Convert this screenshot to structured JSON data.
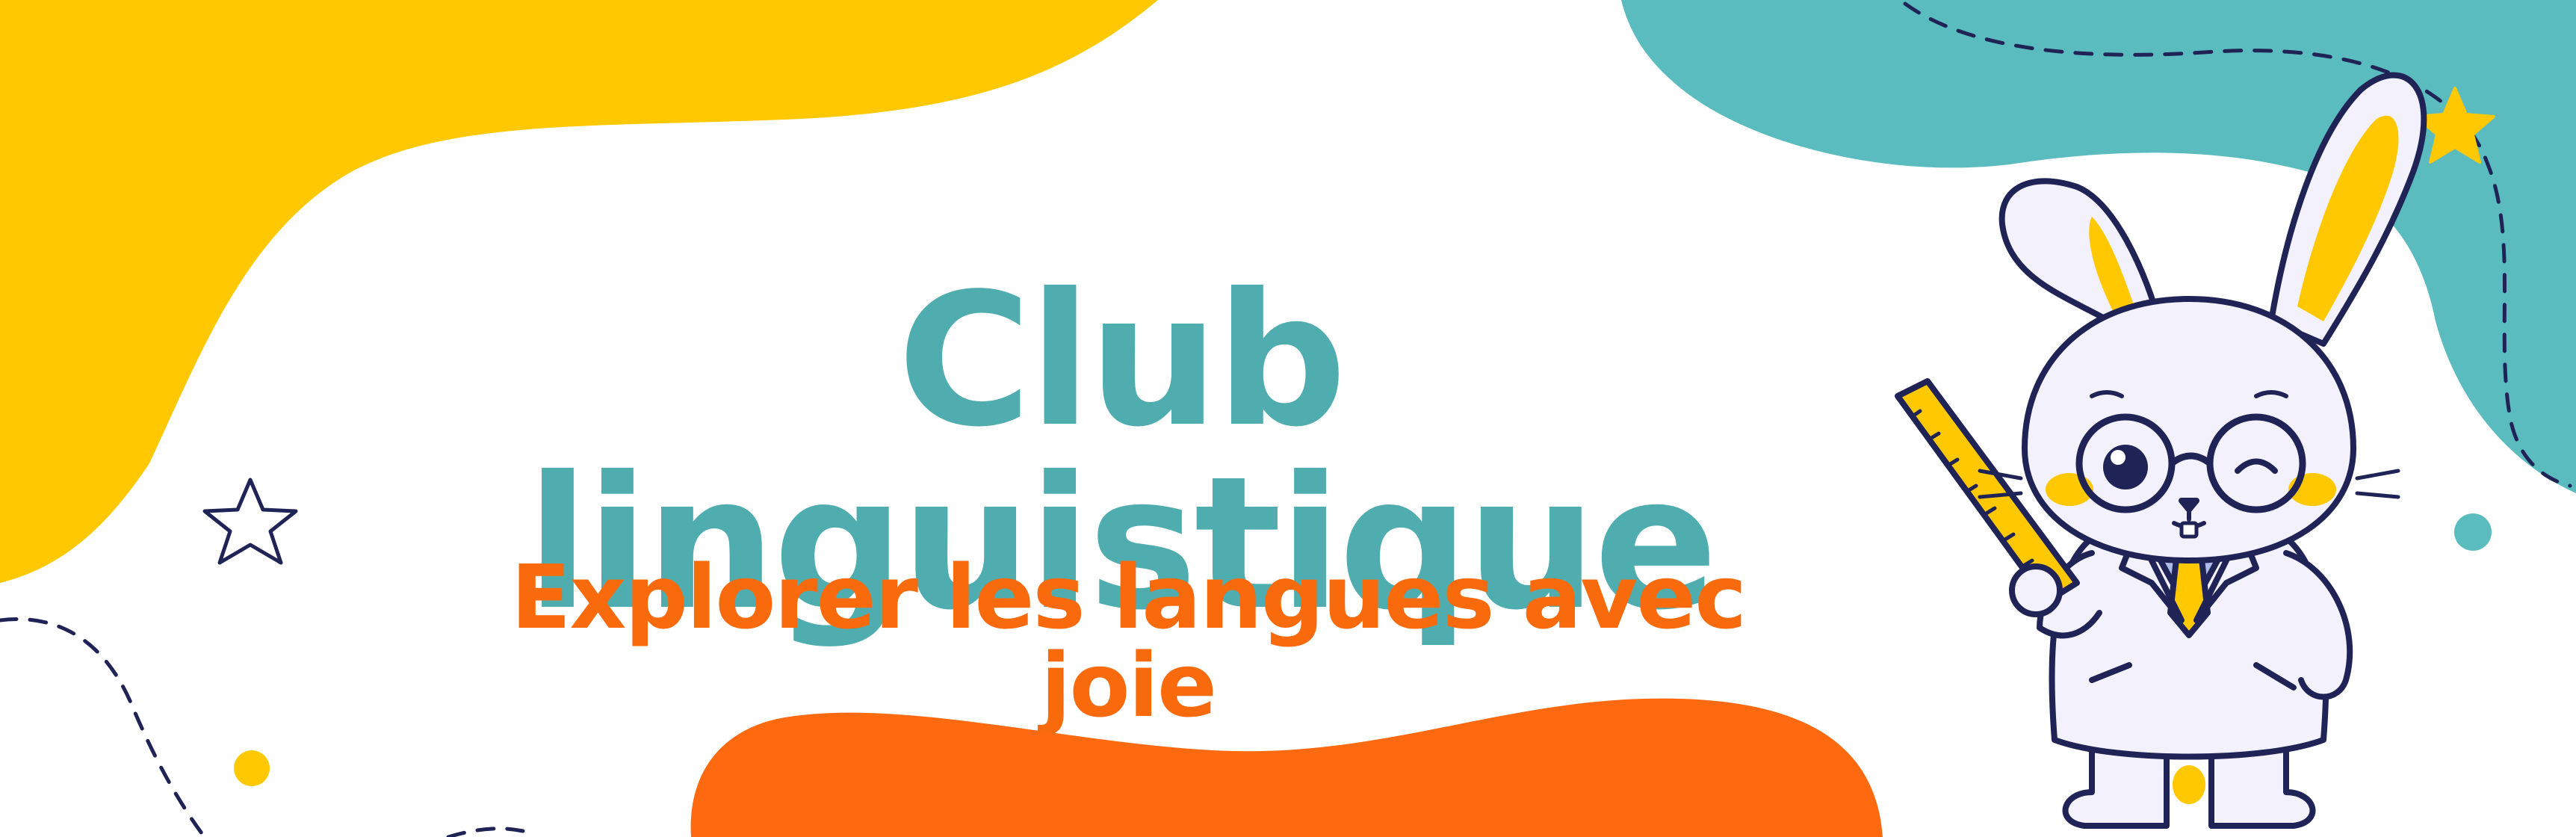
{
  "banner": {
    "title": "Club linguistique",
    "subtitle": "Explorer les langues avec joie"
  },
  "colors": {
    "background": "#ffffff",
    "yellow": "#ffc800",
    "teal": "#5bbcbf",
    "orange": "#ff6a10",
    "title_text": "#4fadb0",
    "subtitle_text": "#f96a0c",
    "navy_outline": "#1f2356",
    "mascot_coat": "#f3f1fb",
    "mascot_shadow": "#cdc6ee"
  },
  "decorations": {
    "mascot": "rabbit-teacher-with-glasses-and-ruler",
    "icons": [
      "star-outline-icon",
      "star-filled-icon",
      "dot-yellow",
      "dot-teal",
      "dashed-path"
    ]
  }
}
